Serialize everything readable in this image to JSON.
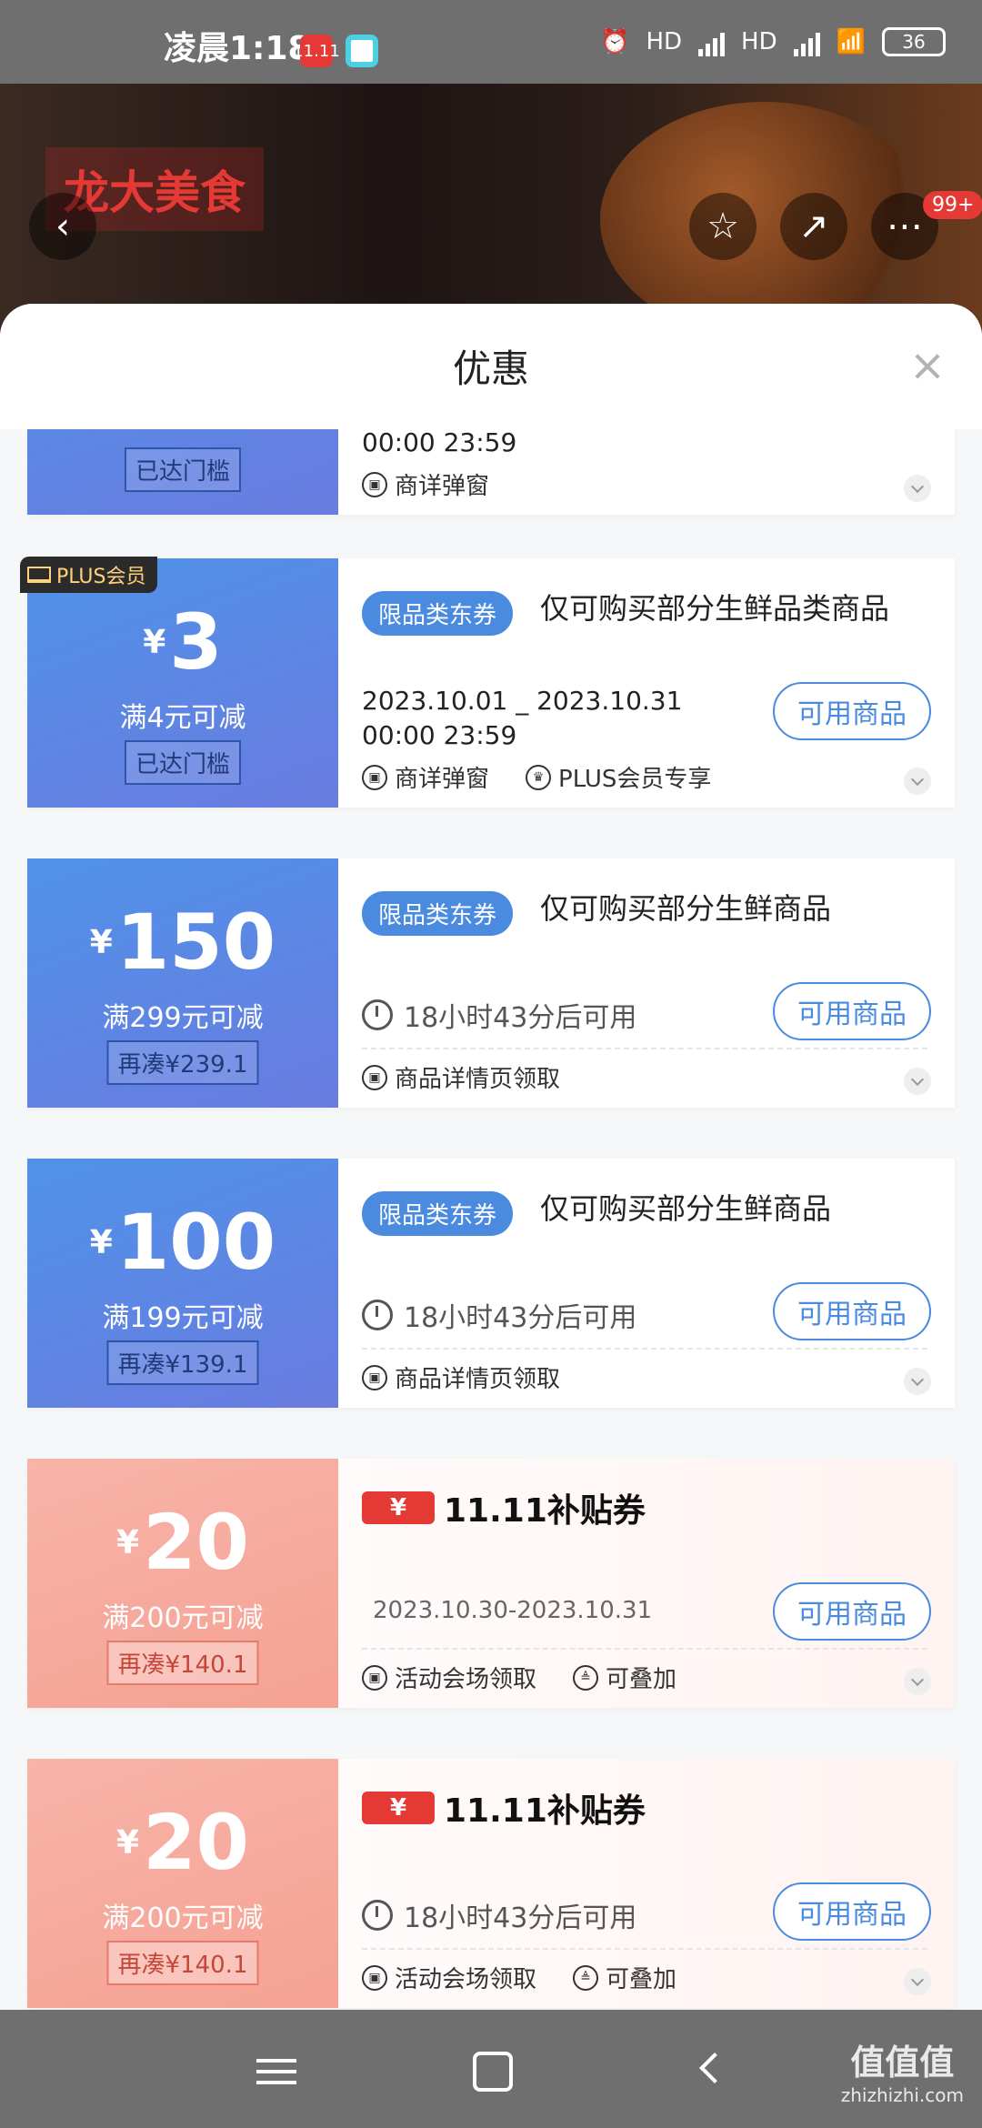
{
  "status_bar": {
    "time": "凌晨1:18",
    "hd1": "HD",
    "hd2": "HD",
    "battery": "36",
    "app1": "11.11"
  },
  "header": {
    "brand": "龙大美食",
    "more_badge": "99+"
  },
  "sheet": {
    "title": "优惠",
    "close": "×"
  },
  "coupons": [
    {
      "id": "c0",
      "type": "blue",
      "pill": "已达门槛",
      "date": "00:00 23:59",
      "feet": [
        "商详弹窗"
      ]
    },
    {
      "id": "c1",
      "type": "blue",
      "badge": "PLUS会员",
      "yen": "¥",
      "amount": "3",
      "cond": "满4元可减",
      "pill": "已达门槛",
      "tag": "限品类东券",
      "desc": "仅可购买部分生鲜品类商品",
      "date1": "2023.10.01 _ 2023.10.31",
      "date2": "00:00 23:59",
      "button": "可用商品",
      "feet": [
        "商详弹窗",
        "PLUS会员专享"
      ]
    },
    {
      "id": "c2",
      "type": "blue",
      "yen": "¥",
      "amount": "150",
      "cond": "满299元可减",
      "pill": "再凑¥239.1",
      "tag": "限品类东券",
      "desc": "仅可购买部分生鲜商品",
      "timer": "18小时43分后可用",
      "button": "可用商品",
      "feet": [
        "商品详情页领取"
      ]
    },
    {
      "id": "c3",
      "type": "blue",
      "yen": "¥",
      "amount": "100",
      "cond": "满199元可减",
      "pill": "再凑¥139.1",
      "tag": "限品类东券",
      "desc": "仅可购买部分生鲜商品",
      "timer": "18小时43分后可用",
      "button": "可用商品",
      "feet": [
        "商品详情页领取"
      ]
    },
    {
      "id": "c4",
      "type": "pink",
      "yen": "¥",
      "amount": "20",
      "cond": "满200元可减",
      "pill": "再凑¥140.1",
      "title_yen": "¥",
      "title": "11.11补贴券",
      "date": "2023.10.30-2023.10.31",
      "button": "可用商品",
      "feet": [
        "活动会场领取",
        "可叠加"
      ]
    },
    {
      "id": "c5",
      "type": "pink",
      "yen": "¥",
      "amount": "20",
      "cond": "满200元可减",
      "pill": "再凑¥140.1",
      "title_yen": "¥",
      "title": "11.11补贴券",
      "timer": "18小时43分后可用",
      "button": "可用商品",
      "feet": [
        "活动会场领取",
        "可叠加"
      ]
    }
  ],
  "watermark": {
    "main": "值值值",
    "sub": "zhizhizhi.com"
  }
}
